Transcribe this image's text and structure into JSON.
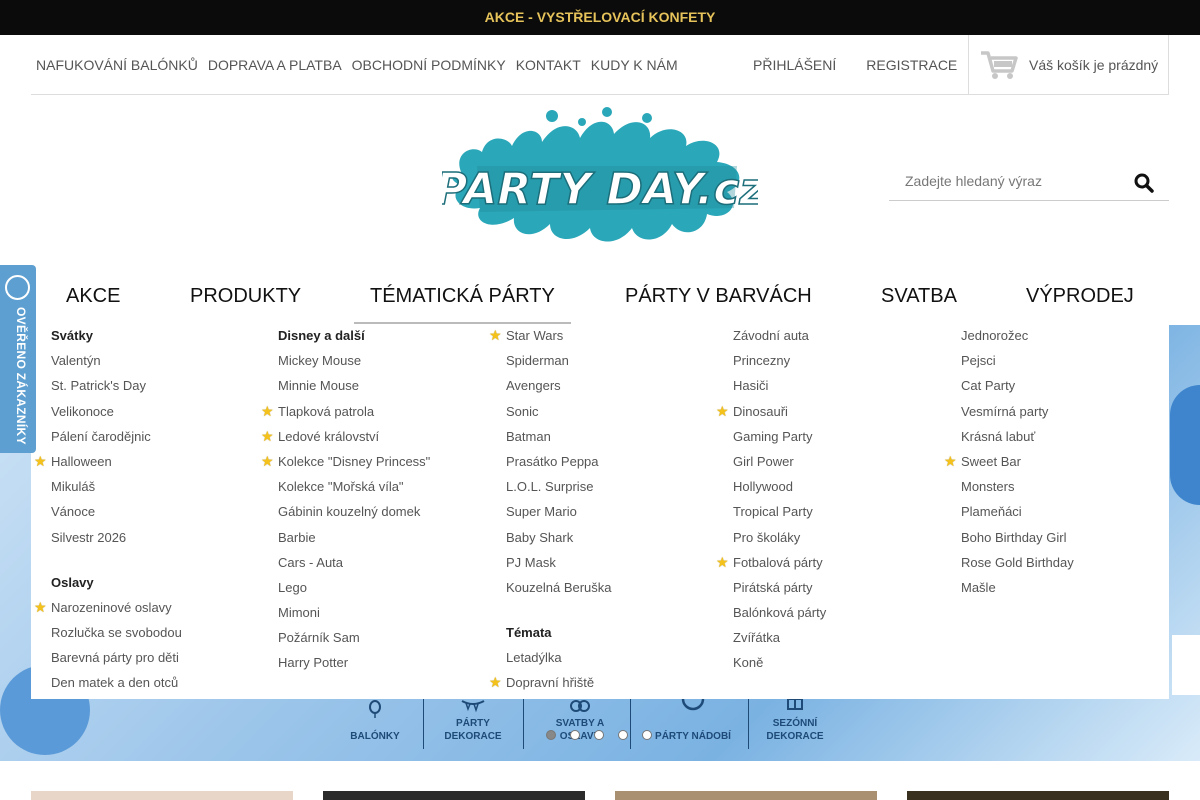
{
  "promo": "AKCE - VYSTŘELOVACÍ KONFETY",
  "topnav": {
    "links": [
      "NAFUKOVÁNÍ BALÓNKŮ",
      "DOPRAVA A PLATBA",
      "OBCHODNÍ PODMÍNKY",
      "KONTAKT",
      "KUDY K NÁM"
    ],
    "login": "PŘIHLÁŠENÍ",
    "register": "REGISTRACE",
    "cart": "Váš košík je prázdný"
  },
  "search": {
    "placeholder": "Zadejte hledaný výraz"
  },
  "badge": {
    "text": "OVĚŘENO ZÁKAZNÍKY"
  },
  "mainnav": [
    "AKCE",
    "PRODUKTY",
    "TÉMATICKÁ PÁRTY",
    "PÁRTY V BARVÁCH",
    "SVATBA",
    "VÝPRODEJ"
  ],
  "dropdown": {
    "col1": {
      "head1": "Svátky",
      "items1": [
        "Valentýn",
        "St. Patrick's Day",
        "Velikonoce",
        "Pálení čarodějnic",
        "Halloween",
        "Mikuláš",
        "Vánoce",
        "Silvestr 2026"
      ],
      "head2": "Oslavy",
      "items2": [
        "Narozeninové oslavy",
        "Rozlučka se svobodou",
        "Barevná párty pro děti",
        "Den matek a den otců"
      ]
    },
    "col2": {
      "head": "Disney a další",
      "items": [
        "Mickey Mouse",
        "Minnie Mouse",
        "Tlapková patrola",
        "Ledové království",
        "Kolekce \"Disney Princess\"",
        "Kolekce \"Mořská víla\"",
        "Gábinin kouzelný domek",
        "Barbie",
        "Cars - Auta",
        "Lego",
        "Mimoni",
        "Požárník Sam",
        "Harry Potter"
      ]
    },
    "col3": {
      "items1": [
        "Star Wars",
        "Spiderman",
        "Avengers",
        "Sonic",
        "Batman",
        "Prasátko Peppa",
        "L.O.L. Surprise",
        "Super Mario",
        "Baby Shark",
        "PJ Mask",
        "Kouzelná Beruška"
      ],
      "head": "Témata",
      "items2": [
        "Letadýlka",
        "Dopravní hřiště"
      ]
    },
    "col4": {
      "items": [
        "Závodní auta",
        "Princezny",
        "Hasiči",
        "Dinosauři",
        "Gaming Party",
        "Girl Power",
        "Hollywood",
        "Tropical Party",
        "Pro školáky",
        "Fotbalová párty",
        "Pirátská párty",
        "Balónková párty",
        "Zvířátka",
        "Koně"
      ]
    },
    "col5": {
      "items": [
        "Jednorožec",
        "Pejsci",
        "Cat Party",
        "Vesmírná party",
        "Krásná labuť",
        "Sweet Bar",
        "Monsters",
        "Plameňáci",
        "Boho Birthday Girl",
        "Rose Gold Birthday",
        "Mašle"
      ]
    }
  },
  "banner_categories": [
    "BALÓNKY",
    "PÁRTY DEKORACE",
    "SVATBY A OSLAVY",
    "PÁRTY NÁDOBÍ",
    "SEZÓNNÍ DEKORACE"
  ],
  "slider": {
    "slides": 5,
    "active": 1
  },
  "colors": {
    "promo_text": "#e6c35a",
    "star": "#f4c21a",
    "badge": "#5d9fd0",
    "logo": "#2aa7b8"
  }
}
